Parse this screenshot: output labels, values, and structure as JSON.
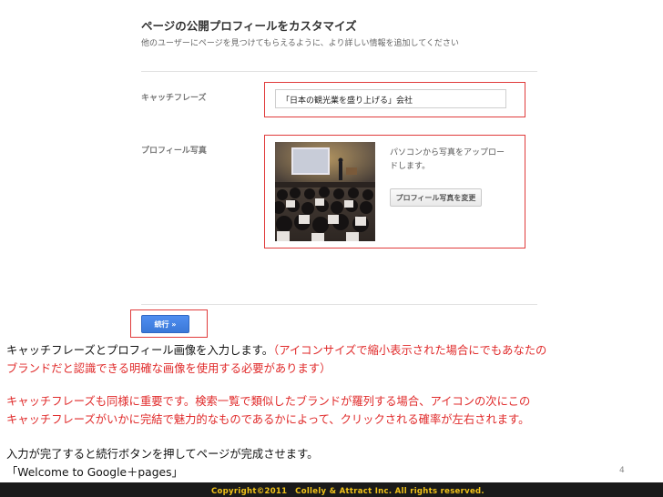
{
  "header": {
    "title": "ページの公開プロフィールをカスタマイズ",
    "subtitle": "他のユーザーにページを見つけてもらえるように、より詳しい情報を追加してください"
  },
  "form": {
    "tagline_label": "キャッチフレーズ",
    "tagline_value": "「日本の観光業を盛り上げる」会社",
    "photo_label": "プロフィール写真",
    "photo_description": "パソコンから写真をアップロードします。",
    "change_photo_button": "プロフィール写真を変更",
    "continue_button": "続行 »"
  },
  "notes": {
    "p1_line1_black": "キャッチフレーズとプロフィール画像を入力します。",
    "p1_line1_red": "（アイコンサイズで縮小表示された場合にでもあなたの",
    "p1_line2_red": "ブランドだと認識できる明確な画像を使用する必要があります）",
    "p2_line1": "キャッチフレーズも同様に重要です。検索一覧で類似したブランドが羅列する場合、アイコンの次にこの",
    "p2_line2": "キャッチフレーズがいかに完結で魅力的なものであるかによって、クリックされる確率が左右されます。",
    "p3_line1": "入力が完了すると続行ボタンを押してページが完成させます。",
    "p3_line2": "「Welcome to Google＋pages」"
  },
  "footer": {
    "copyright": "Copyright©2011　Collely & Attract Inc. All rights reserved.",
    "page_number": "4"
  },
  "colors": {
    "highlight_border": "#e03b3b",
    "note_red": "#e02a2a",
    "primary_button": "#3a78d8",
    "footer_bg": "#1a1a1a",
    "copyright_text": "#f2c318"
  }
}
